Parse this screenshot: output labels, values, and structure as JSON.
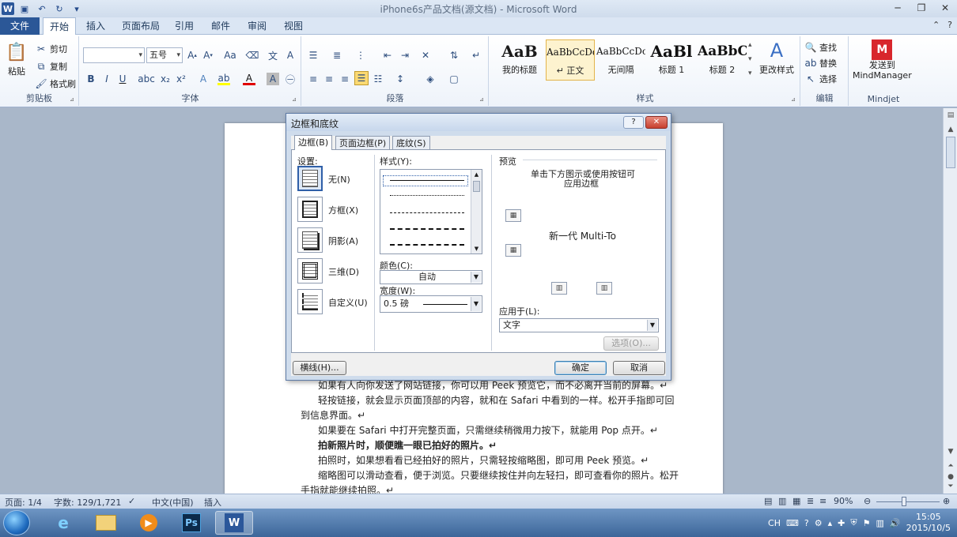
{
  "window": {
    "title": "iPhone6s产品文档(源文档) - Microsoft Word"
  },
  "ribbon_tabs": [
    {
      "label": "文件"
    },
    {
      "label": "开始"
    },
    {
      "label": "插入"
    },
    {
      "label": "页面布局"
    },
    {
      "label": "引用"
    },
    {
      "label": "邮件"
    },
    {
      "label": "审阅"
    },
    {
      "label": "视图"
    }
  ],
  "clipboard": {
    "paste": "粘贴",
    "cut": "剪切",
    "copy": "复制",
    "format_painter": "格式刷",
    "group_label": "剪贴板"
  },
  "font": {
    "font_name": "",
    "font_size": "五号",
    "group_label": "字体"
  },
  "paragraph": {
    "group_label": "段落"
  },
  "styles": {
    "items": [
      {
        "sample": "AaB",
        "name": "我的标题"
      },
      {
        "sample": "AaBbCcDd",
        "name": "↵ 正文"
      },
      {
        "sample": "AaBbCcDc",
        "name": "无间隔"
      },
      {
        "sample": "AaBl",
        "name": "标题 1"
      },
      {
        "sample": "AaBbC",
        "name": "标题 2"
      }
    ],
    "change_styles": "更改样式",
    "group_label": "样式"
  },
  "editing": {
    "find": "查找",
    "replace": "替换",
    "select": "选择",
    "group_label": "编辑"
  },
  "mindjet": {
    "send_line1": "发送到",
    "send_line2": "MindManager",
    "group_label": "Mindjet"
  },
  "document": {
    "lines": [
      "如果有人向你发送了网站链接，你可以用 Peek 预览它，而不必离开当前的屏幕。↵",
      "轻按链接，就会显示页面顶部的内容，就和在 Safari 中看到的一样。松开手指即可回",
      "到信息界面。↵",
      "如果要在 Safari 中打开完整页面，只需继续稍微用力按下，就能用 Pop 点开。↵",
      "拍新照片时，顺便瞧一眼已拍好的照片。↵",
      "拍照时，如果想看看已经拍好的照片，只需轻按缩略图，即可用 Peek 预览。↵",
      "缩略图可以滑动查看，便于浏览。只要继续按住并向左轻扫，即可查看你的照片。松开",
      "手指就能继续拍照。↵"
    ]
  },
  "dialog": {
    "title": "边框和底纹",
    "tabs": [
      {
        "label": "边框(B)"
      },
      {
        "label": "页面边框(P)"
      },
      {
        "label": "底纹(S)"
      }
    ],
    "settings_label": "设置:",
    "settings": [
      {
        "label": "无(N)"
      },
      {
        "label": "方框(X)"
      },
      {
        "label": "阴影(A)"
      },
      {
        "label": "三维(D)"
      },
      {
        "label": "自定义(U)"
      }
    ],
    "style_label": "样式(Y):",
    "color_label": "颜色(C):",
    "color_value": "自动",
    "width_label": "宽度(W):",
    "width_value": "0.5 磅",
    "preview_label": "预览",
    "preview_hint_line1": "单击下方图示或使用按钮可",
    "preview_hint_line2": "应用边框",
    "preview_text": "新一代 Multi-To",
    "apply_to_label": "应用于(L):",
    "apply_to_value": "文字",
    "options_button": "选项(O)...",
    "horizontal_line_button": "横线(H)...",
    "ok_button": "确定",
    "cancel_button": "取消"
  },
  "statusbar": {
    "page": "页面: 1/4",
    "words": "字数: 129/1,721",
    "language": "中文(中国)",
    "mode": "插入",
    "zoom": "90%"
  },
  "taskbar": {
    "ime": "CH",
    "time": "15:05",
    "date": "2015/10/5"
  }
}
